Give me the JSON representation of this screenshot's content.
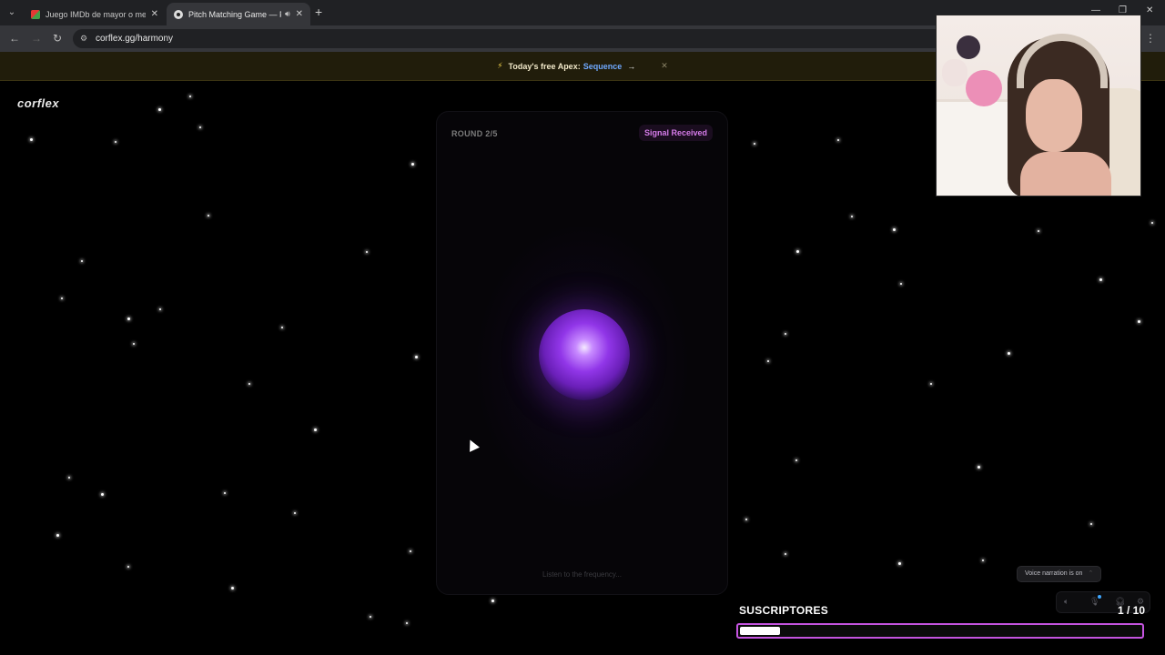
{
  "browser": {
    "tabs": [
      {
        "title": "Juego IMDb de mayor o menor"
      },
      {
        "title": "Pitch Matching Game — Free"
      }
    ],
    "url": "corflex.gg/harmony"
  },
  "promo": {
    "text": "Today's free Apex:",
    "link": "Sequence",
    "arrow": "→",
    "close": "✕"
  },
  "site": {
    "logo": "corflex"
  },
  "game": {
    "round_label": "ROUND 2/5",
    "status_badge": "Signal Received",
    "hint": "Listen to the frequency..."
  },
  "narration": {
    "label": "Voice narration is on"
  },
  "overlay": {
    "subs_label": "SUSCRIPTORES",
    "subs_count": "1 / 10",
    "subs_progress": 0.1
  },
  "colors": {
    "accent_purple": "#c554e0",
    "badge_text": "#d47be8",
    "link_blue": "#6fa9ff",
    "promo_bg": "#211d0b"
  },
  "icons": {
    "promo": "bolt-icon",
    "orb": "pitch-orb",
    "controls": [
      "speaker-icon",
      "microphone-icon",
      "headphones-icon",
      "settings-icon"
    ]
  }
}
